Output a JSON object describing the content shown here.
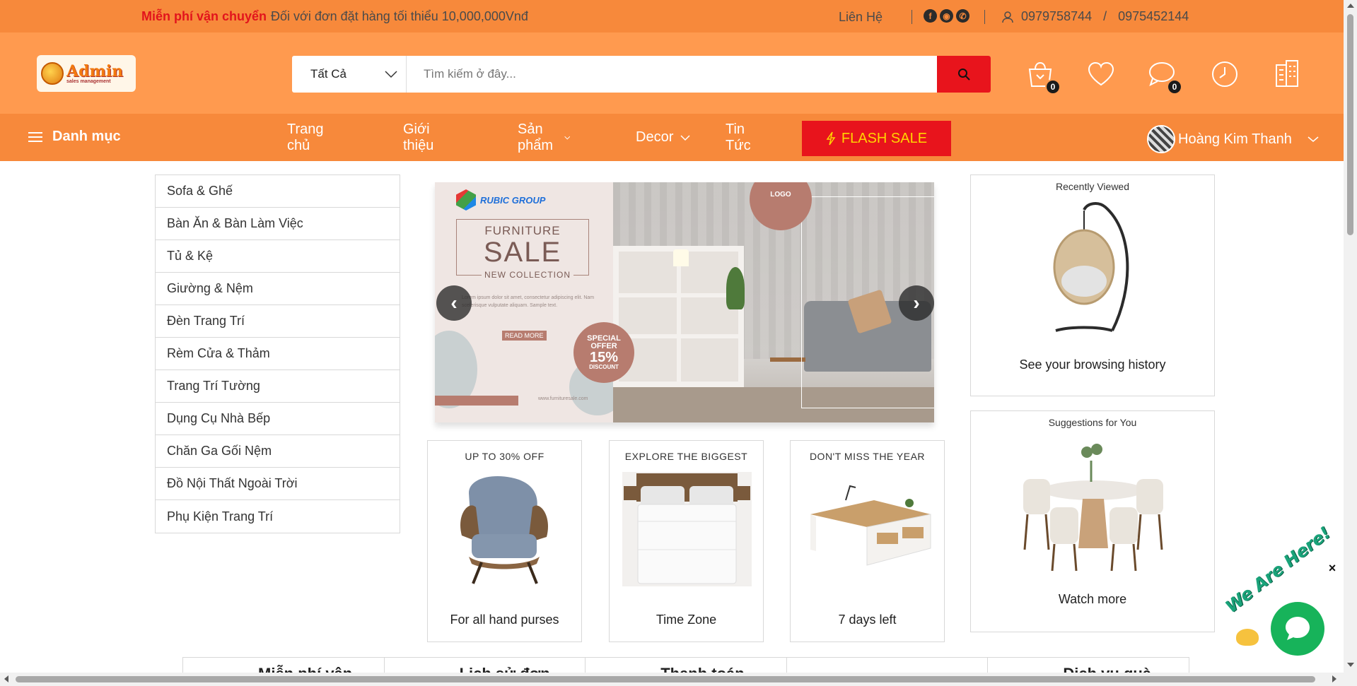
{
  "topbar": {
    "promo_highlight": "Miễn phí vận chuyển",
    "promo_text": "Đối với đơn đặt hàng tối thiểu 10,000,000Vnđ",
    "contact": "Liên Hệ",
    "social_icons": [
      "facebook-icon",
      "github-icon",
      "whatsapp-icon"
    ],
    "phone_1": "0979758744",
    "phone_sep": "/",
    "phone_2": "0975452144"
  },
  "header": {
    "logo_text": "Admin",
    "logo_subtext": "sales management",
    "search_category": "Tất Cả",
    "search_placeholder": "Tìm kiếm ở đây...",
    "cart_count": "0",
    "messages_count": "0"
  },
  "nav": {
    "menu_label": "Danh mục",
    "links": [
      "Trang chủ",
      "Giới thiệu",
      "Sản phẩm",
      "Decor",
      "Tin Tức"
    ],
    "flash_sale": "FLASH SALE",
    "user_name": "Hoàng Kim Thanh"
  },
  "categories": [
    "Sofa & Ghế",
    "Bàn Ăn & Bàn Làm Việc",
    "Tủ & Kệ",
    "Giường & Nệm",
    "Đèn Trang Trí",
    "Rèm Cửa & Thảm",
    "Trang Trí Tường",
    "Dụng Cụ Nhà Bếp",
    "Chăn Ga Gối Nệm",
    "Đồ Nội Thất Ngoài Trời",
    "Phụ Kiện Trang Trí"
  ],
  "banner": {
    "brand": "RUBIC GROUP",
    "title_top": "FURNITURE",
    "title_main": "SALE",
    "subtitle": "NEW COLLECTION",
    "body": "Lorem ipsum dolor sit amet, consectetur adipiscing elit. Nam scelerisque vulputate aliquam. Sample text.",
    "read_more": "READ MORE",
    "offer_1": "SPECIAL OFFER",
    "offer_2": "15%",
    "offer_3": "DISCOUNT",
    "logo_badge": "LOGO",
    "website": "www.furnituresale.com",
    "prev_arrow": "‹",
    "next_arrow": "›"
  },
  "promo_cards": [
    {
      "title": "UP TO 30% OFF",
      "caption": "For all hand purses"
    },
    {
      "title": "EXPLORE THE BIGGEST",
      "caption": "Time Zone"
    },
    {
      "title": "DON'T MISS THE YEAR",
      "caption": "7 days left"
    }
  ],
  "side_cards": [
    {
      "title": "Recently Viewed",
      "caption": "See your browsing history"
    },
    {
      "title": "Suggestions for You",
      "caption": "Watch more"
    }
  ],
  "features": [
    "Miễn phí vận",
    "Lịch sử đơn",
    "Thanh toán",
    "",
    "Dịch vụ quà"
  ],
  "chat": {
    "label": "We Are Here!",
    "close": "×"
  },
  "colors": {
    "topbar": "#f7893b",
    "header": "#ff9a4f",
    "accent_red": "#e8141c",
    "flash_text": "#ffd400",
    "chat_green": "#17b35a"
  }
}
